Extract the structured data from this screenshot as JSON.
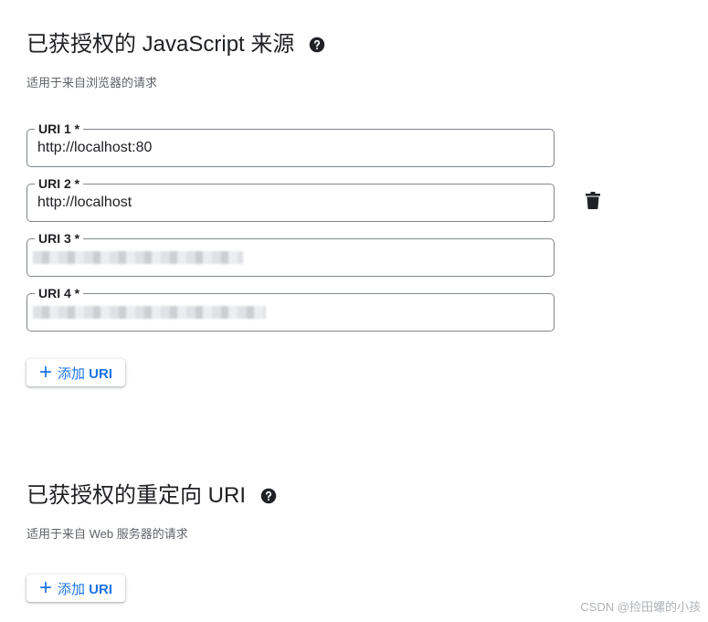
{
  "js_origins": {
    "title": "已获授权的 JavaScript 来源",
    "subtitle": "适用于来自浏览器的请求",
    "uris": [
      {
        "label": "URI 1 *",
        "value": "http://localhost:80"
      },
      {
        "label": "URI 2 *",
        "value": "http://localhost"
      },
      {
        "label": "URI 3 *",
        "value": ""
      },
      {
        "label": "URI 4 *",
        "value": ""
      }
    ],
    "add_button": {
      "prefix": "添加 ",
      "suffix": "URI"
    }
  },
  "redirect_uris": {
    "title": "已获授权的重定向 URI",
    "subtitle": "适用于来自 Web 服务器的请求",
    "add_button": {
      "prefix": "添加 ",
      "suffix": "URI"
    }
  },
  "icons": {
    "help": "help-circle-icon",
    "delete": "trash-icon",
    "add": "plus-icon"
  },
  "colors": {
    "accent": "#1a73e8",
    "text": "#202124",
    "secondary_text": "#5f6368",
    "border": "#80868b"
  },
  "watermark": "CSDN @捡田螺的小孩"
}
